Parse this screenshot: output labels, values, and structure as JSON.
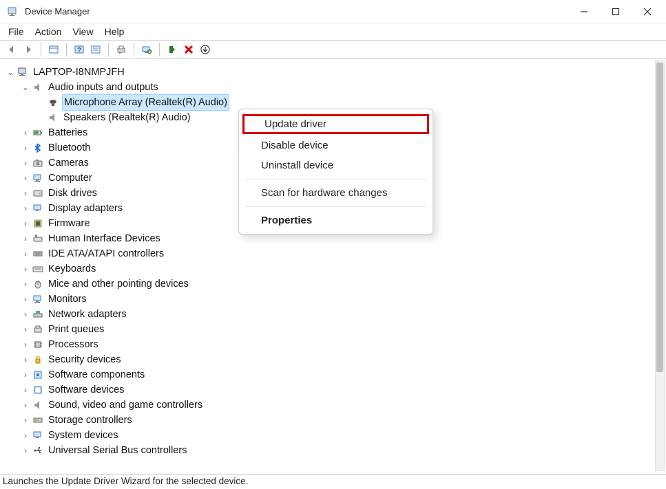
{
  "window": {
    "title": "Device Manager"
  },
  "menubar": [
    "File",
    "Action",
    "View",
    "Help"
  ],
  "statusbar": "Launches the Update Driver Wizard for the selected device.",
  "root": "LAPTOP-I8NMPJFH",
  "audio_category": "Audio inputs and outputs",
  "audio_children": [
    "Microphone Array (Realtek(R) Audio)",
    "Speakers (Realtek(R) Audio)"
  ],
  "categories": [
    "Batteries",
    "Bluetooth",
    "Cameras",
    "Computer",
    "Disk drives",
    "Display adapters",
    "Firmware",
    "Human Interface Devices",
    "IDE ATA/ATAPI controllers",
    "Keyboards",
    "Mice and other pointing devices",
    "Monitors",
    "Network adapters",
    "Print queues",
    "Processors",
    "Security devices",
    "Software components",
    "Software devices",
    "Sound, video and game controllers",
    "Storage controllers",
    "System devices",
    "Universal Serial Bus controllers"
  ],
  "context_menu": {
    "update": "Update driver",
    "disable": "Disable device",
    "uninstall": "Uninstall device",
    "scan": "Scan for hardware changes",
    "properties": "Properties"
  }
}
